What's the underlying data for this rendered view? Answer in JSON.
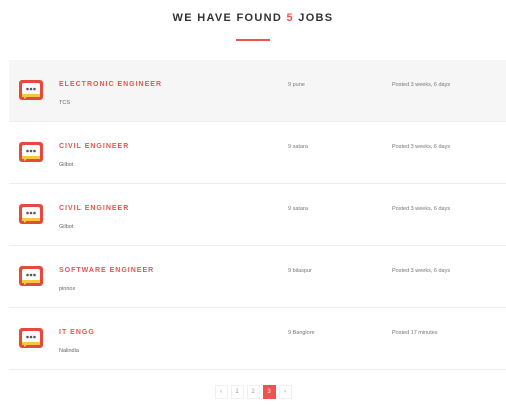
{
  "heading": {
    "prefix": "WE HAVE FOUND",
    "count": "5",
    "suffix": "JOBS"
  },
  "jobs": [
    {
      "title": "ELECTRONIC ENGINEER",
      "company": "TCS",
      "location": "9 pune",
      "posted": "Posted 3 weeks, 6 days",
      "highlighted": true
    },
    {
      "title": "CIVIL ENGINEER",
      "company": "Gilbot",
      "location": "9 satara",
      "posted": "Posted 3 weeks, 6 days",
      "highlighted": false
    },
    {
      "title": "CIVIL ENGINEER",
      "company": "Gilbot",
      "location": "9 satara",
      "posted": "Posted 3 weeks, 6 days",
      "highlighted": false
    },
    {
      "title": "SOFTWARE ENGINEER",
      "company": "pinnox",
      "location": "9 bilaspur",
      "posted": "Posted 3 weeks, 6 days",
      "highlighted": false
    },
    {
      "title": "IT ENGG",
      "company": "Nalindia",
      "location": "9 Banglore",
      "posted": "Posted 17 minutes",
      "highlighted": false
    }
  ],
  "pagination": {
    "prev": "‹",
    "pages": [
      "1",
      "2"
    ],
    "active_page": "3",
    "next": "›"
  },
  "colors": {
    "accent": "#ef5350",
    "logo_outer": "#e64a3c",
    "logo_inner": "#f7c548"
  },
  "icons": {
    "job_logo": "chat-bubble-icon"
  }
}
